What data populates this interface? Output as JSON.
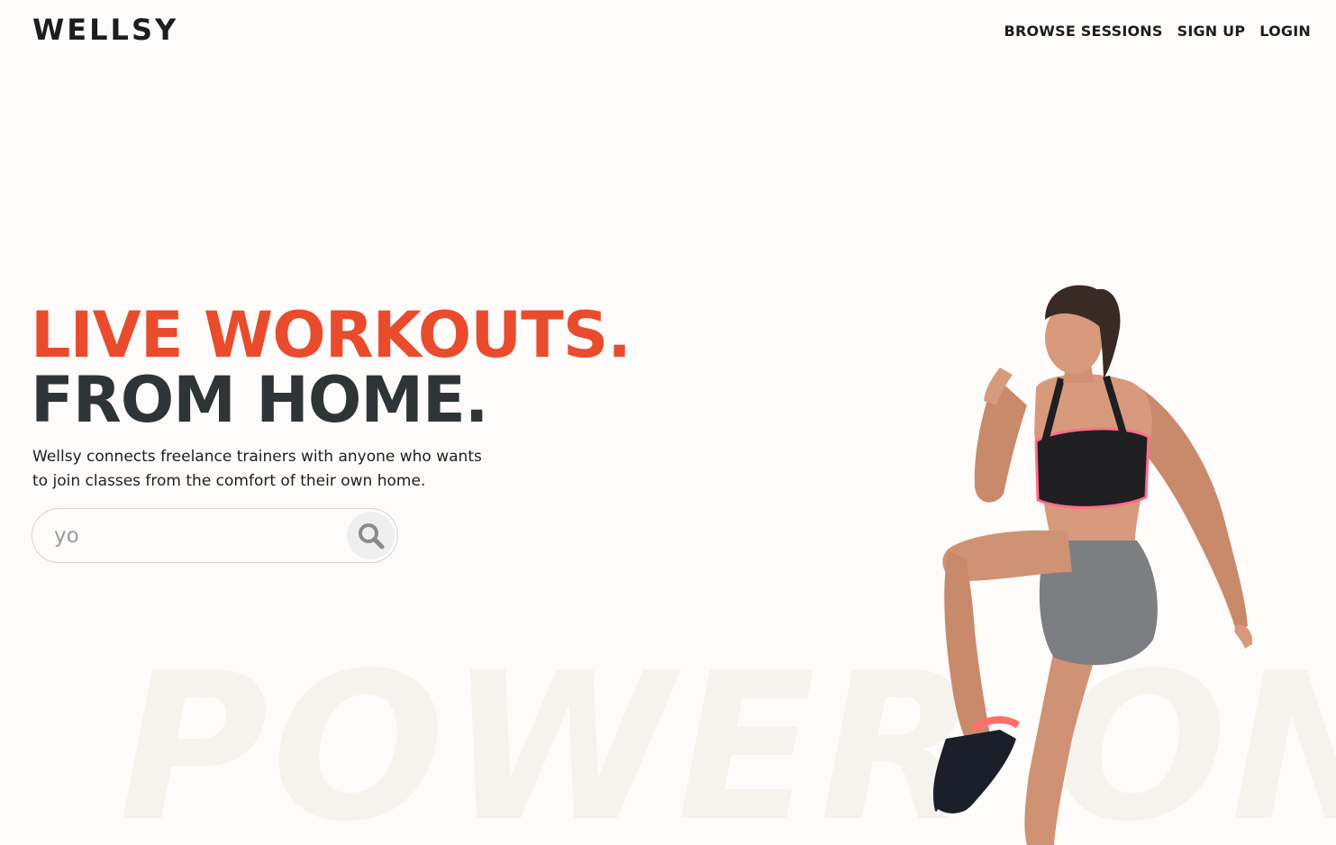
{
  "brand": {
    "logo": "WELLSY"
  },
  "nav": {
    "items": [
      {
        "label": "BROWSE SESSIONS"
      },
      {
        "label": "SIGN UP"
      },
      {
        "label": "LOGIN"
      }
    ]
  },
  "hero": {
    "headline_line1": "LIVE WORKOUTS.",
    "headline_line2": "FROM HOME.",
    "tagline_line1": "Wellsy connects freelance trainers with anyone who wants",
    "tagline_line2": "to join classes from the comfort of their own home.",
    "background_word": "POWER ON"
  },
  "search": {
    "value": "yo",
    "icon": "search-icon"
  },
  "colors": {
    "accent": "#e94c2d",
    "dark": "#2f3436",
    "background": "#fdfcfb"
  }
}
